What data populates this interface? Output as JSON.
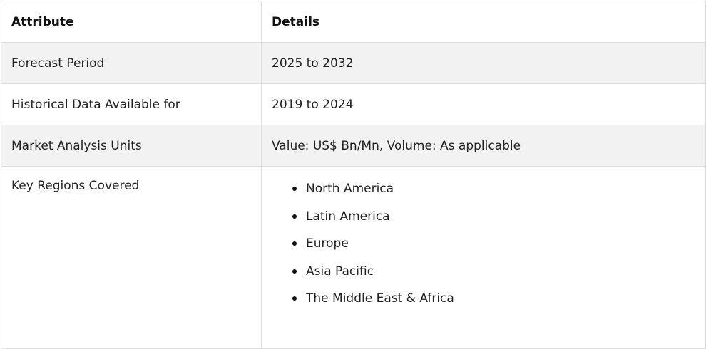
{
  "table": {
    "headers": [
      "Attribute",
      "Details"
    ],
    "rows": [
      {
        "attribute": "Forecast Period",
        "details": "2025 to 2032"
      },
      {
        "attribute": "Historical Data Available for",
        "details": "2019 to 2024"
      },
      {
        "attribute": "Market Analysis Units",
        "details": "Value: US$ Bn/Mn, Volume: As applicable"
      }
    ],
    "regions_row": {
      "attribute": "Key Regions Covered",
      "regions": [
        "North America",
        "Latin America",
        "Europe",
        "Asia Pacific",
        "The Middle East & Africa"
      ]
    }
  },
  "colors": {
    "header_bg": "#ffffff",
    "shaded_row_bg": "#f2f2f2",
    "border": "#dddddd",
    "text": "#222222"
  }
}
